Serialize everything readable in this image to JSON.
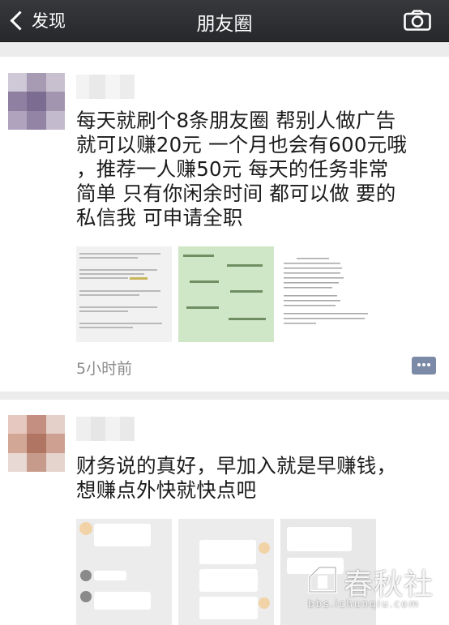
{
  "header": {
    "back_label": "发现",
    "title": "朋友圈"
  },
  "posts": [
    {
      "text_lines": [
        "每天就刷个8条朋友圈  帮别人做广告",
        "就可以赚20元  一个月也会有600元哦",
        "，推荐一人赚50元    每天的任务非常",
        "简单 只有你闲余时间 都可以做 要的",
        "私信我 可申请全职"
      ],
      "time": "5小时前"
    },
    {
      "text_lines": [
        "财务说的真好，早加入就是早赚钱，",
        "想赚点外快就快点吧"
      ]
    }
  ],
  "watermark": {
    "brand": "春秋社",
    "url": "bbs.ichunqiu.com"
  },
  "colors": {
    "header_bg": "#2e2f33",
    "link_blue": "#7b8aa6",
    "time_gray": "#8b8b8b"
  }
}
